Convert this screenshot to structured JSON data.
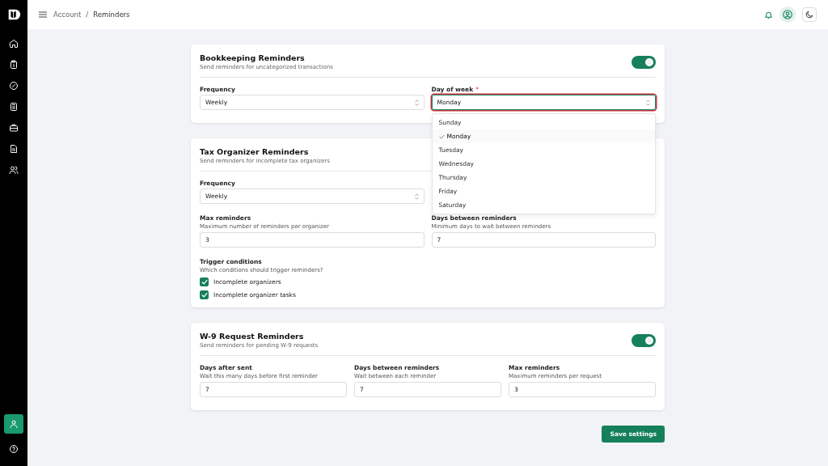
{
  "breadcrumb": {
    "parent": "Account",
    "current": "Reminders",
    "separator": "/"
  },
  "sidebar": {
    "items": [
      {
        "kind": "home",
        "selected": false
      },
      {
        "kind": "clipboard",
        "selected": false
      },
      {
        "kind": "compass",
        "selected": false
      },
      {
        "kind": "calculator",
        "selected": false
      },
      {
        "kind": "briefcase",
        "selected": false
      },
      {
        "kind": "document",
        "selected": false
      },
      {
        "kind": "users",
        "selected": false
      }
    ],
    "bottom": [
      {
        "kind": "user",
        "selected": true
      },
      {
        "kind": "help",
        "selected": false
      }
    ]
  },
  "sections": [
    {
      "title": "Bookkeeping Reminders",
      "subtitle": "Send reminders for uncategorized transactions",
      "toggle": {
        "on": true
      },
      "rows": [
        {
          "fields": [
            {
              "kind": "select",
              "label": "Frequency",
              "value": "Weekly",
              "focused": false
            },
            {
              "kind": "select",
              "label": "Day of week",
              "required_mark": "*",
              "value": "Monday",
              "focused": true,
              "dropdown": {
                "options": [
                  {
                    "label": "Sunday",
                    "selected": false
                  },
                  {
                    "label": "Monday",
                    "selected": true
                  },
                  {
                    "label": "Tuesday",
                    "selected": false
                  },
                  {
                    "label": "Wednesday",
                    "selected": false
                  },
                  {
                    "label": "Thursday",
                    "selected": false
                  },
                  {
                    "label": "Friday",
                    "selected": false
                  },
                  {
                    "label": "Saturday",
                    "selected": false
                  }
                ]
              }
            }
          ]
        }
      ]
    },
    {
      "title": "Tax Organizer Reminders",
      "subtitle": "Send reminders for incomplete tax organizers",
      "rows": [
        {
          "fields": [
            {
              "kind": "select",
              "label": "Frequency",
              "value": "Weekly",
              "focused": false
            }
          ]
        },
        {
          "fields": [
            {
              "kind": "input",
              "label": "Max reminders",
              "hint": "Maximum number of reminders per organizer",
              "value": "3"
            },
            {
              "kind": "input",
              "label": "Days between reminders",
              "hint": "Minimum days to wait between reminders",
              "value": "7"
            }
          ]
        }
      ],
      "checks": {
        "label": "Trigger conditions",
        "hint": "Which conditions should trigger reminders?",
        "items": [
          {
            "label": "Incomplete organizers",
            "checked": true
          },
          {
            "label": "Incomplete organizer tasks",
            "checked": true
          }
        ]
      }
    },
    {
      "title": "W-9 Request Reminders",
      "subtitle": "Send reminders for pending W-9 requests",
      "toggle": {
        "on": true
      },
      "rows": [
        {
          "fields": [
            {
              "kind": "input",
              "label": "Days after sent",
              "hint": "Wait this many days before first reminder",
              "value": "7"
            },
            {
              "kind": "input",
              "label": "Days between reminders",
              "hint": "Wait between each reminder",
              "value": "7"
            },
            {
              "kind": "input",
              "label": "Max reminders",
              "hint": "Maximum reminders per request",
              "value": "3"
            }
          ]
        }
      ]
    }
  ],
  "save_button": "Save settings"
}
